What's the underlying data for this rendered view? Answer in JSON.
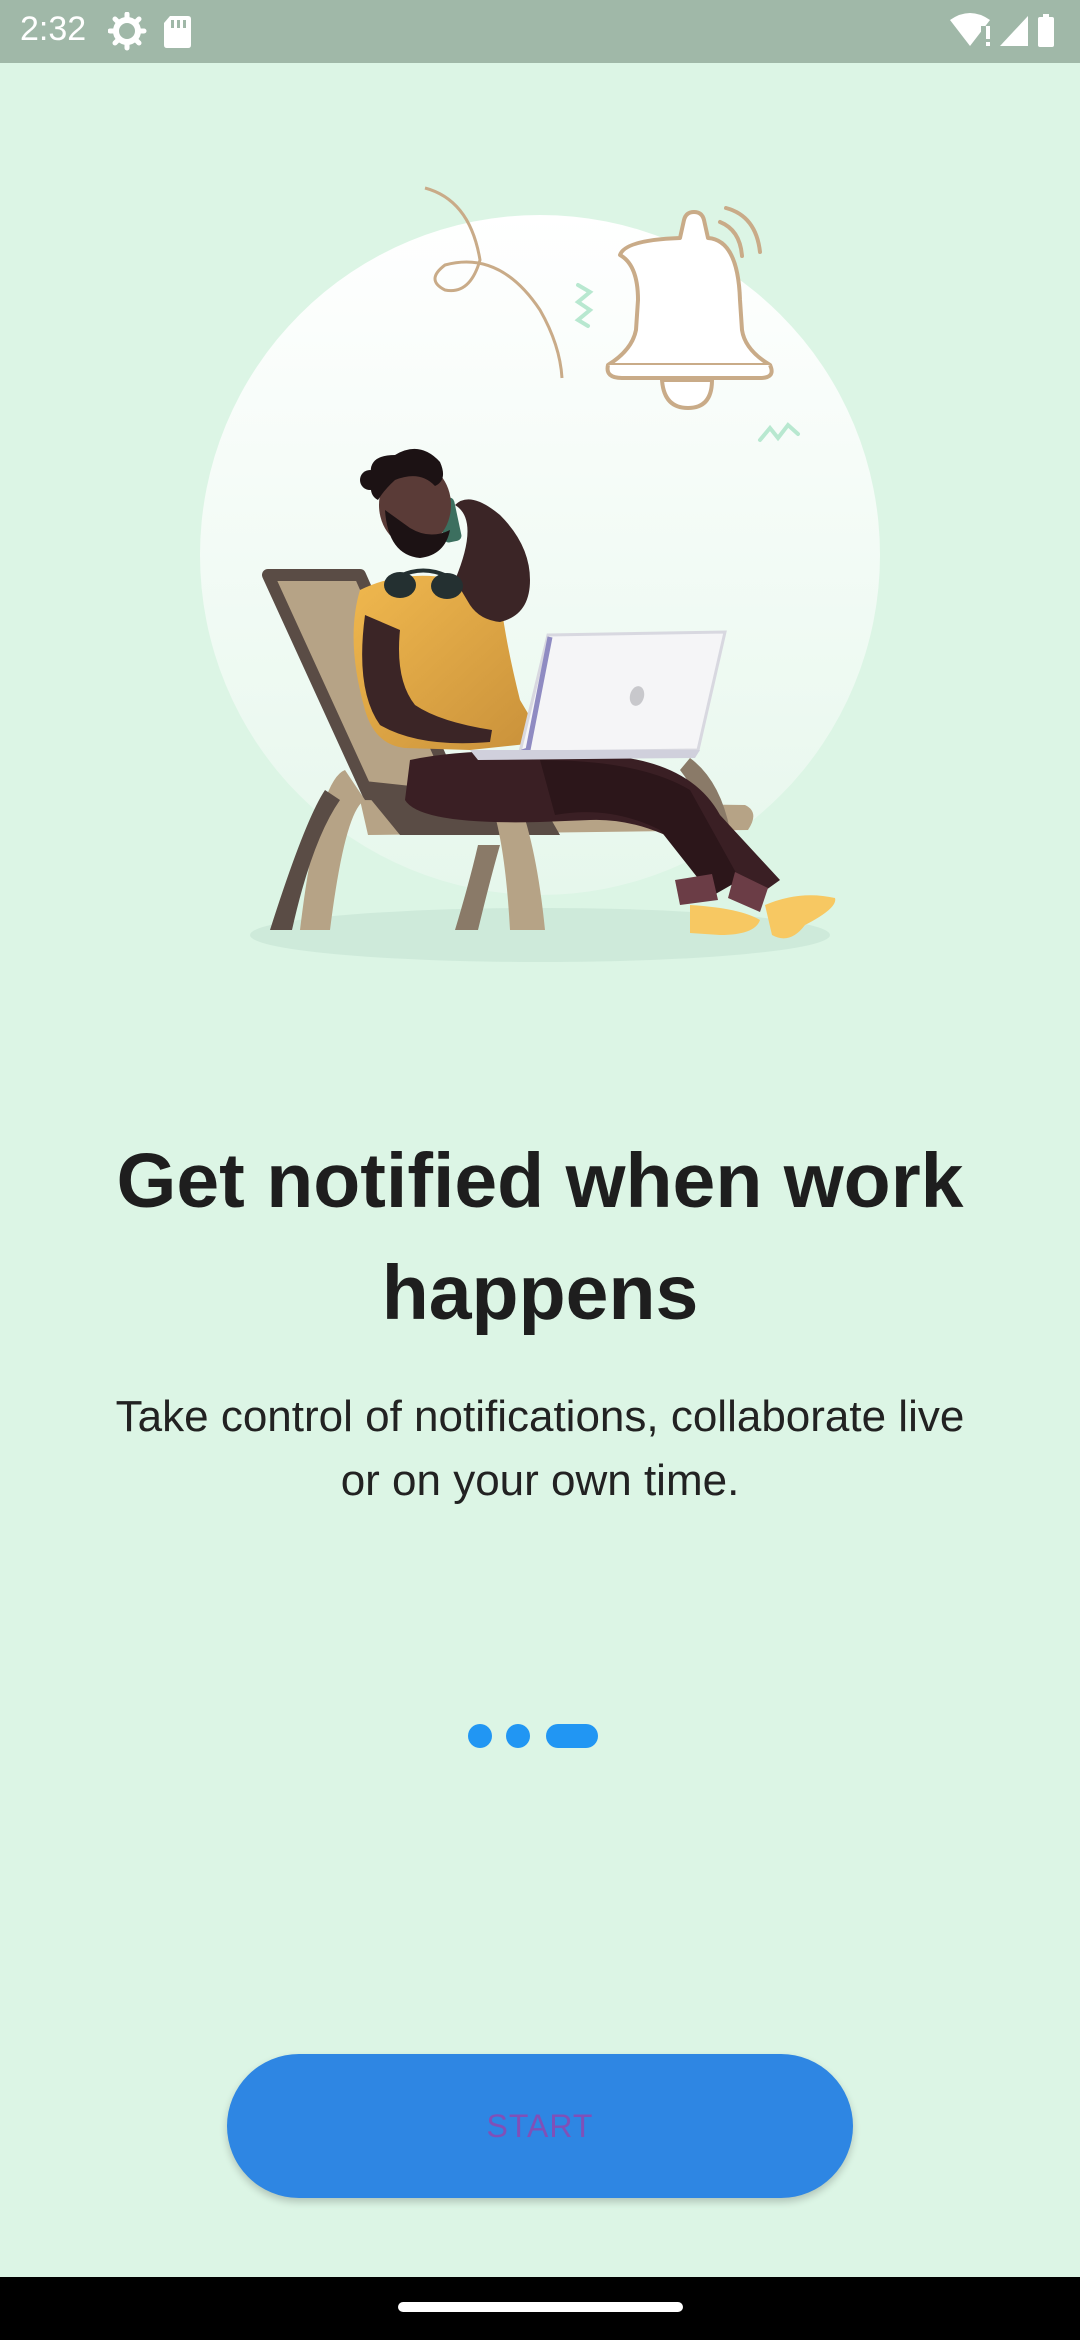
{
  "status_bar": {
    "time": "2:32",
    "left_icons": [
      "settings-gear-icon",
      "sd-card-icon"
    ],
    "right_icons": [
      "wifi-icon",
      "signal-icon",
      "battery-icon"
    ]
  },
  "illustration": {
    "subject": "person-on-phone-with-laptop-icon",
    "accent_icon": "bell-icon"
  },
  "onboarding": {
    "title": "Get notified when work happens",
    "subtitle": "Take control of notifications, collaborate live or on your own time.",
    "page_indicator": {
      "total": 3,
      "current": 3
    },
    "start_label": "START"
  },
  "colors": {
    "background": "#dcf5e5",
    "status_bar": "#a0b8a8",
    "accent": "#2196f3",
    "button": "#2e86e3",
    "button_text": "#8050b8"
  }
}
